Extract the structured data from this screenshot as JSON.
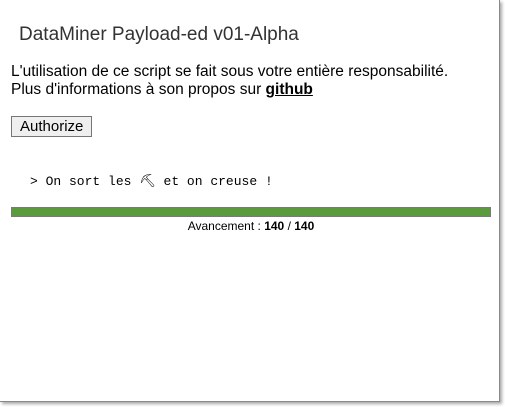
{
  "dialog": {
    "title": "DataMiner Payload-ed v01-Alpha",
    "description_line1": "L'utilisation de ce script se fait sous votre entière responsabilité.",
    "description_line2_prefix": "Plus d'informations à son propos sur ",
    "github_link": "github",
    "authorize_button": "Authorize"
  },
  "log": {
    "message": "> On sort les ⛏ et on creuse !"
  },
  "progress": {
    "label": "Avancement : ",
    "current": "140",
    "separator": " / ",
    "total": "140",
    "fraction": 1.0,
    "color": "#5c9a3e"
  }
}
